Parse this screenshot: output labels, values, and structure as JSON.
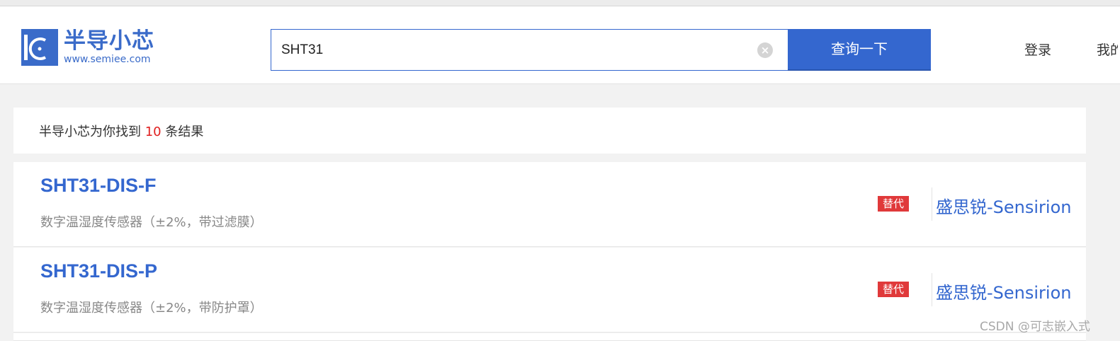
{
  "header": {
    "logo_name": "半导小芯",
    "logo_url": "www.semiee.com",
    "search_value": "SHT31",
    "search_button": "查询一下",
    "nav_login": "登录",
    "nav_mine": "我的"
  },
  "summary": {
    "prefix": "半导小芯为你找到",
    "count": "10",
    "suffix": "条结果"
  },
  "results": [
    {
      "part": "SHT31-DIS-F",
      "desc": "数字温湿度传感器（±2%，带过滤膜）",
      "tag": "替代",
      "brand": "盛思锐-Sensirion"
    },
    {
      "part": "SHT31-DIS-P",
      "desc": "数字温湿度传感器（±2%，带防护罩）",
      "tag": "替代",
      "brand": "盛思锐-Sensirion"
    }
  ],
  "watermark": "CSDN @可志嵌入式",
  "colors": {
    "accent": "#3467cf",
    "tag_bg": "#e0393a",
    "count": "#e02020"
  }
}
